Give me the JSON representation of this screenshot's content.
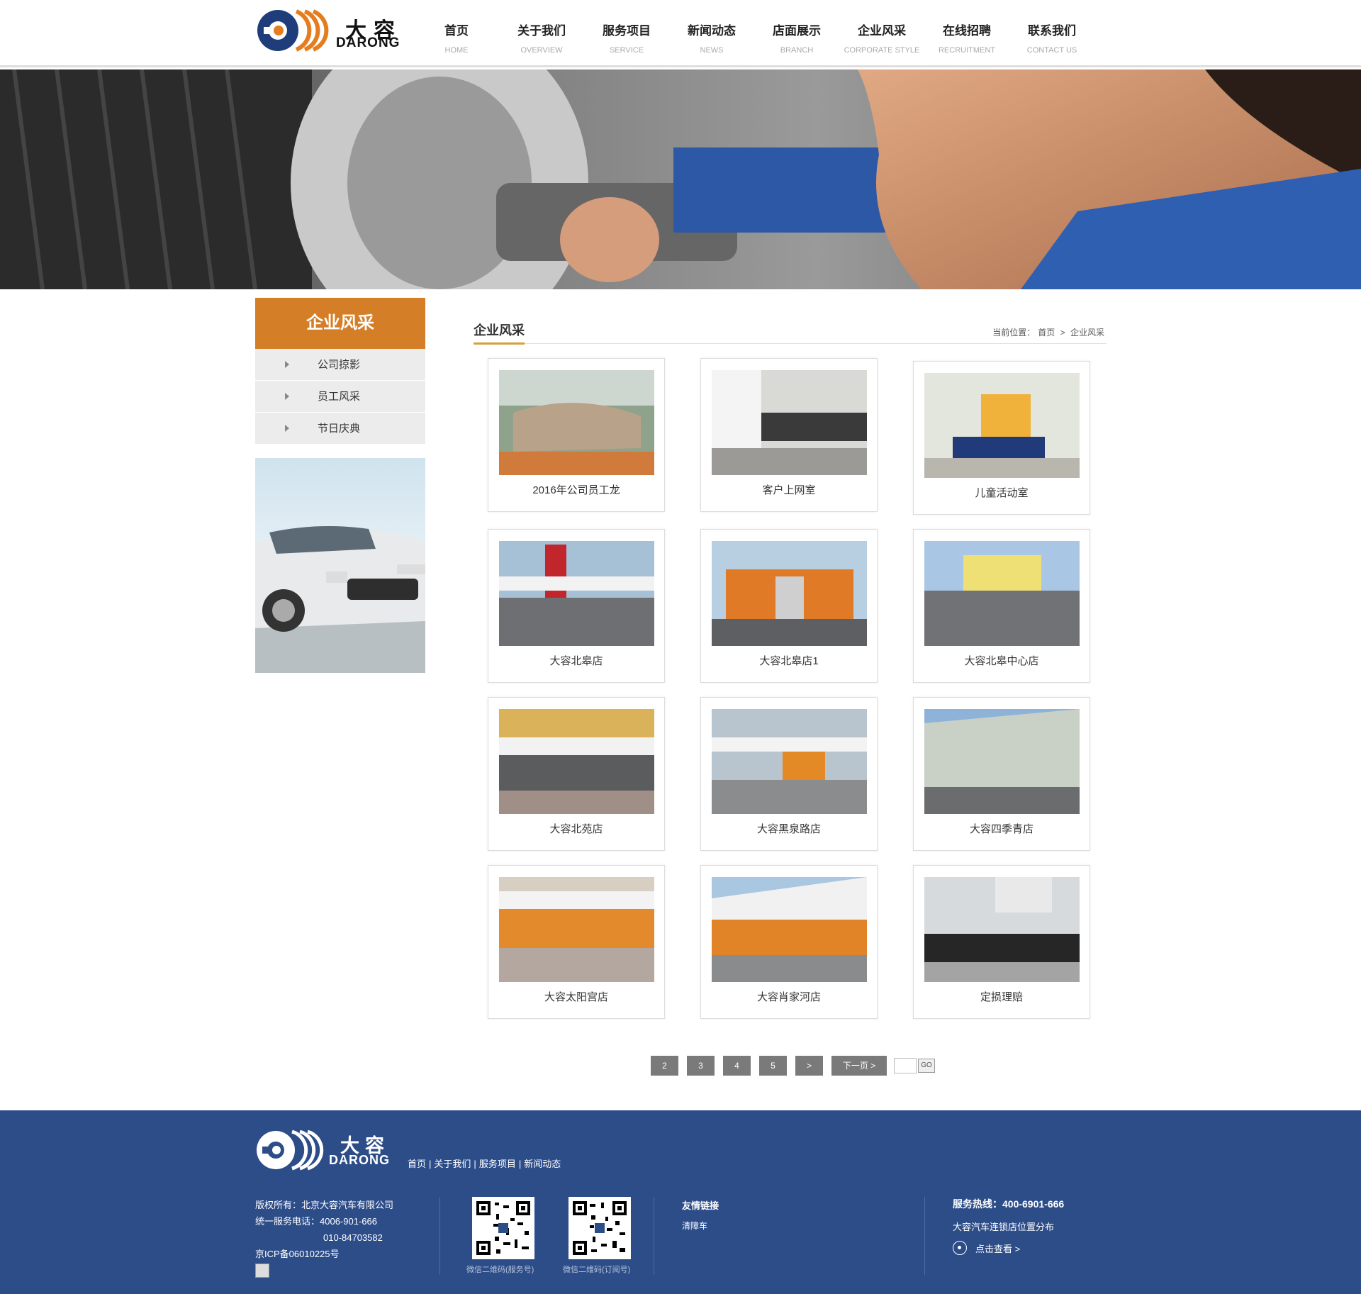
{
  "header": {
    "logo_cn": "大容",
    "logo_en": "DARONG",
    "nav": [
      {
        "cn": "首页",
        "en": "HOME"
      },
      {
        "cn": "关于我们",
        "en": "OVERVIEW"
      },
      {
        "cn": "服务项目",
        "en": "SERVICE"
      },
      {
        "cn": "新闻动态",
        "en": "NEWS"
      },
      {
        "cn": "店面展示",
        "en": "BRANCH"
      },
      {
        "cn": "企业风采",
        "en": "CORPORATE STYLE"
      },
      {
        "cn": "在线招聘",
        "en": "RECRUITMENT"
      },
      {
        "cn": "联系我们",
        "en": "CONTACT US"
      }
    ]
  },
  "sidebar": {
    "title": "企业风采",
    "items": [
      {
        "label": "公司掠影"
      },
      {
        "label": "员工风采"
      },
      {
        "label": "节日庆典"
      }
    ]
  },
  "main": {
    "title": "企业风采",
    "breadcrumb": {
      "prefix": "当前位置：",
      "home": "首页",
      "sep": ">",
      "current": "企业风采"
    },
    "cards": [
      {
        "caption": "2016年公司员工龙"
      },
      {
        "caption": "客户上网室"
      },
      {
        "caption": "儿童活动室"
      },
      {
        "caption": "大容北皋店"
      },
      {
        "caption": "大容北皋店1"
      },
      {
        "caption": "大容北皋中心店"
      },
      {
        "caption": "大容北苑店"
      },
      {
        "caption": "大容黑泉路店"
      },
      {
        "caption": "大容四季青店"
      },
      {
        "caption": "大容太阳宫店"
      },
      {
        "caption": "大容肖家河店"
      },
      {
        "caption": "定损理赔"
      }
    ]
  },
  "pagination": {
    "pages": [
      "2",
      "3",
      "4",
      "5",
      ">"
    ],
    "next": "下一页 >",
    "go": "GO"
  },
  "footer": {
    "logo_cn": "大容",
    "logo_en": "DARONG",
    "links": [
      "首页",
      "关于我们",
      "服务项目",
      "新闻动态"
    ],
    "link_sep": "|",
    "copyright": "版权所有：北京大容汽车有限公司",
    "service_phone": "统一服务电话：4006-901-666",
    "phone2": "010-84703582",
    "icp": "京ICP备06010225号",
    "qr1_caption": "微信二维码(服务号)",
    "qr2_caption": "微信二维码(订阅号)",
    "friend_links_title": "友情链接",
    "friend_link": "清障车",
    "hotline": "服务热线：400-6901-666",
    "stores": "大容汽车连锁店位置分布",
    "view": "点击查看 >"
  },
  "colors": {
    "accent_orange": "#d47e27",
    "footer_blue": "#2d4d89",
    "logo_blue": "#1f3d7a",
    "pager_gray": "#7a7a7a"
  }
}
